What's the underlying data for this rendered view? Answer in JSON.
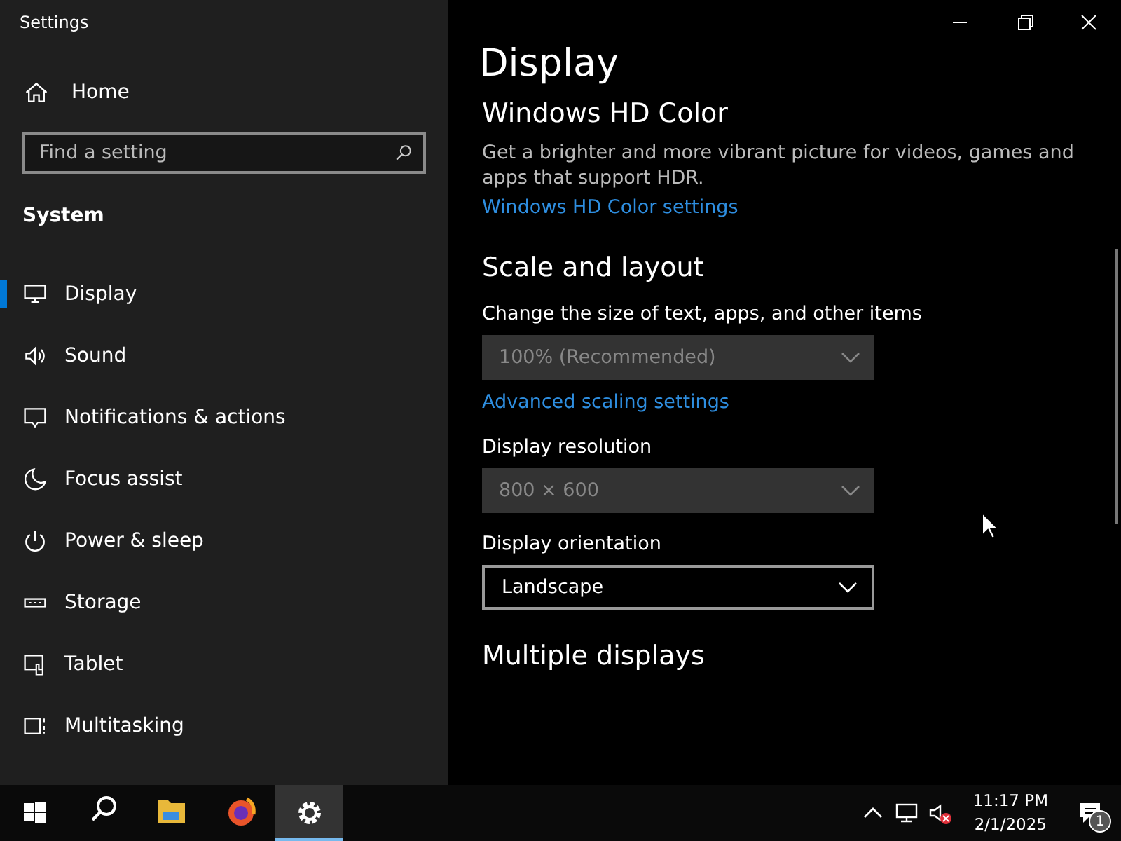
{
  "window": {
    "title": "Settings"
  },
  "sidebar": {
    "home": "Home",
    "search": {
      "placeholder": "Find a setting"
    },
    "section": "System",
    "items": [
      {
        "label": "Display",
        "selected": true
      },
      {
        "label": "Sound",
        "selected": false
      },
      {
        "label": "Notifications & actions",
        "selected": false
      },
      {
        "label": "Focus assist",
        "selected": false
      },
      {
        "label": "Power & sleep",
        "selected": false
      },
      {
        "label": "Storage",
        "selected": false
      },
      {
        "label": "Tablet",
        "selected": false
      },
      {
        "label": "Multitasking",
        "selected": false
      }
    ]
  },
  "content": {
    "title": "Display",
    "blocks": [
      {
        "kind": "heading",
        "text": "Windows HD Color"
      },
      {
        "kind": "text",
        "text": "Get a brighter and more vibrant picture for videos, games and apps that support HDR."
      },
      {
        "kind": "link",
        "text": "Windows HD Color settings"
      },
      {
        "kind": "heading",
        "text": "Scale and layout"
      },
      {
        "kind": "label",
        "text": "Change the size of text, apps, and other items"
      },
      {
        "kind": "dropdown",
        "value": "100% (Recommended)",
        "disabled": true
      },
      {
        "kind": "link",
        "text": "Advanced scaling settings"
      },
      {
        "kind": "label",
        "text": "Display resolution"
      },
      {
        "kind": "dropdown",
        "value": "800 × 600",
        "disabled": true
      },
      {
        "kind": "label",
        "text": "Display orientation"
      },
      {
        "kind": "dropdown",
        "value": "Landscape",
        "disabled": false
      },
      {
        "kind": "heading",
        "text": "Multiple displays"
      }
    ]
  },
  "taskbar": {
    "apps": [
      {
        "selected": false
      },
      {
        "selected": false
      },
      {
        "selected": false
      },
      {
        "selected": false
      },
      {
        "selected": true
      }
    ],
    "time": "11:17 PM",
    "date": "2/1/2025",
    "notification_count": "1"
  }
}
